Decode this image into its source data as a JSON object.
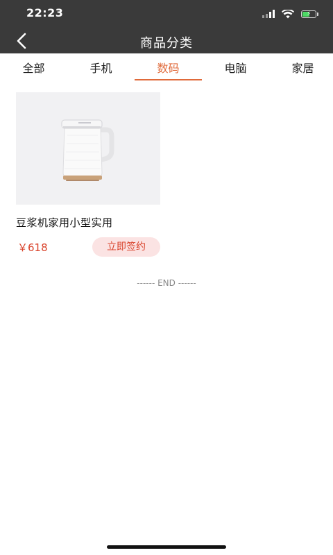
{
  "status_bar": {
    "time": "22:23",
    "icons": [
      "signal-icon",
      "wifi-icon",
      "battery-charging-icon"
    ],
    "battery_color": "#4cd964",
    "battery_level": 0.5
  },
  "nav": {
    "title": "商品分类",
    "back_icon": "chevron-left-icon",
    "background": "#3a3a3a"
  },
  "tabs": {
    "items": [
      {
        "label": "全部",
        "active": false
      },
      {
        "label": "手机",
        "active": false
      },
      {
        "label": "数码",
        "active": true
      },
      {
        "label": "电脑",
        "active": false
      },
      {
        "label": "家居",
        "active": false
      }
    ],
    "active_color": "#e06a3a"
  },
  "products": [
    {
      "name": "豆浆机家用小型实用",
      "price": "￥618",
      "action_label": "立即签约",
      "image_icon": "soymilk-maker-image"
    }
  ],
  "footer": {
    "end_text": "------ END ------"
  },
  "colors": {
    "price": "#d9422a",
    "button_bg": "#fbe3e3"
  }
}
